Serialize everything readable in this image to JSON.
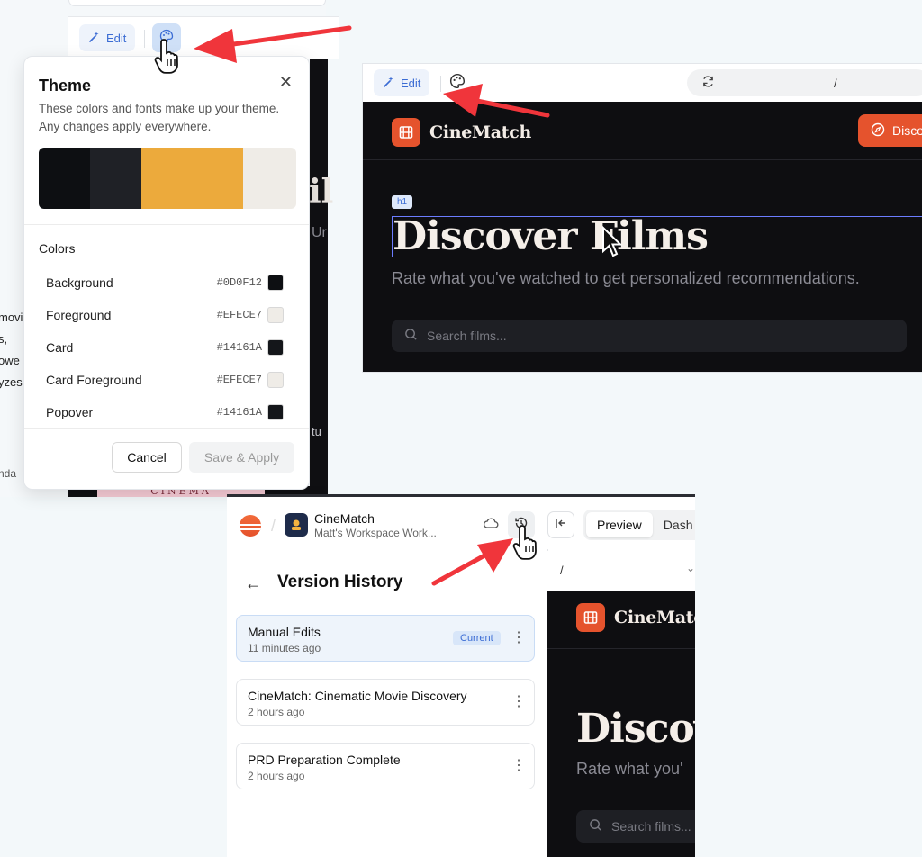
{
  "theme_panel": {
    "edit_label": "Edit",
    "title": "Theme",
    "description": "These colors and fonts make up your theme. Any changes apply everywhere.",
    "swatch_colors": [
      "#0D0F12",
      "#1F2126",
      "#ECAA3C",
      "#EFECE7"
    ],
    "colors_heading": "Colors",
    "colors": [
      {
        "label": "Background",
        "hex": "#0D0F12",
        "swatch": "#0D0F12"
      },
      {
        "label": "Foreground",
        "hex": "#EFECE7",
        "swatch": "#EFECE7"
      },
      {
        "label": "Card",
        "hex": "#14161A",
        "swatch": "#14161A"
      },
      {
        "label": "Card Foreground",
        "hex": "#EFECE7",
        "swatch": "#EFECE7"
      },
      {
        "label": "Popover",
        "hex": "#14161A",
        "swatch": "#14161A"
      }
    ],
    "cancel_label": "Cancel",
    "save_label": "Save & Apply"
  },
  "background_fragments": {
    "left_lines": [
      "movi",
      "s,",
      "owe",
      "yzes",
      "nda"
    ],
    "right_lines": [
      "il",
      "Ur",
      "tu"
    ],
    "bottom_text": "CINEMA"
  },
  "preview_panel": {
    "edit_label": "Edit",
    "url_path": "/",
    "brand_name": "CineMatch",
    "discover_button_label": "Disco",
    "h1_tag": "h1",
    "heading": "Discover Films",
    "subtitle": "Rate what you've watched to get personalized recommendations.",
    "search_placeholder": "Search films..."
  },
  "version_panel": {
    "project_name": "CineMatch",
    "workspace": "Matt's Workspace Work...",
    "tab_preview": "Preview",
    "tab_dash": "Dash",
    "title": "Version History",
    "versions": [
      {
        "title": "Manual Edits",
        "time": "11 minutes ago",
        "badge": "Current"
      },
      {
        "title": "CineMatch: Cinematic Movie Discovery",
        "time": "2 hours ago"
      },
      {
        "title": "PRD Preparation Complete",
        "time": "2 hours ago"
      }
    ],
    "url_path": "/",
    "brand_name": "CineMatch",
    "heading_partial": "Discov",
    "subtitle_partial": "Rate what you'",
    "search_partial": "Search films..."
  },
  "accent_colors": {
    "arrow": "#F0353B",
    "brand_orange": "#E5532D",
    "link_blue": "#3B6CD4"
  }
}
